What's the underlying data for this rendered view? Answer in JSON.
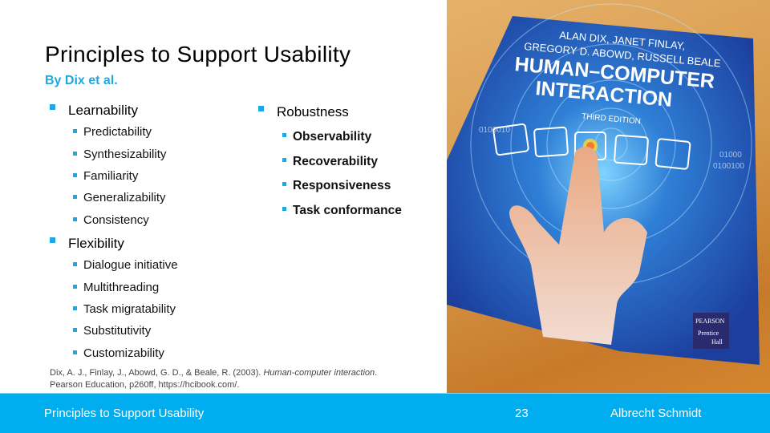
{
  "slide": {
    "title": "Principles to Support Usability",
    "subtitle": "By Dix et al.",
    "accent_color": "#1fa8df"
  },
  "left_column": {
    "learnability": {
      "label": "Learnability",
      "items": [
        "Predictability",
        "Synthesizability",
        "Familiarity",
        "Generalizability",
        "Consistency"
      ]
    },
    "flexibility": {
      "label": "Flexibility",
      "items": [
        "Dialogue initiative",
        "Multithreading",
        "Task migratability",
        "Substitutivity",
        "Customizability"
      ]
    }
  },
  "right_column": {
    "robustness": {
      "label": "Robustness",
      "items": [
        "Observability",
        "Recoverability",
        "Responsiveness",
        "Task conformance"
      ]
    }
  },
  "citation": {
    "text_before": "Dix, A. J., Finlay, J., Abowd, G. D., & Beale, R. (2003). ",
    "title_italic": "Human-computer interaction",
    "text_after": ".",
    "line2": "Pearson Education, p260ff, https://hcibook.com/."
  },
  "book_photo": {
    "authors_line1": "ALAN DIX, JANET FINLAY,",
    "authors_line2": "GREGORY D. ABOWD, RUSSELL BEALE",
    "title_line1": "HUMAN–COMPUTER",
    "title_line2": "INTERACTION",
    "edition": "THIRD EDITION",
    "publisher_1": "PEARSON",
    "publisher_2": "Prentice",
    "publisher_3": "Hall",
    "binary_1": "0100010",
    "binary_2": "01000",
    "binary_3": "0100100"
  },
  "footer": {
    "title": "Principles to Support Usability",
    "page_number": "23",
    "author": "Albrecht Schmidt",
    "background_color": "#00adef"
  }
}
